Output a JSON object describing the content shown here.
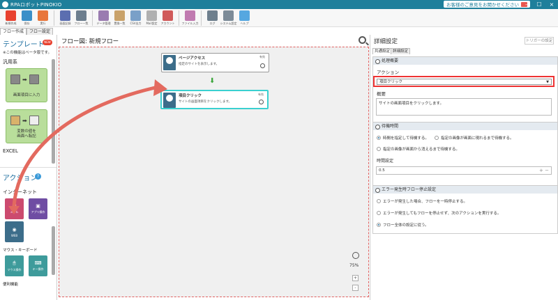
{
  "app": {
    "title": "RPAロボットPINOKIO",
    "feedback": "お客様のご意見をお聞かせください"
  },
  "toolbar": {
    "buttons": [
      {
        "label": "新規作成",
        "icon": "new-doc-icon",
        "color": "#e8412f"
      },
      {
        "label": "保存",
        "icon": "save-icon",
        "color": "#3b8fc8"
      },
      {
        "label": "実行",
        "icon": "run-icon",
        "color": "#e8763b"
      },
      {
        "label": "画面記録",
        "icon": "record-icon",
        "color": "#5b6eb0"
      },
      {
        "label": "フロー一覧",
        "icon": "list-icon",
        "color": "#6d7e8e"
      },
      {
        "label": "データ管理",
        "icon": "database-icon",
        "color": "#9a7bb0"
      },
      {
        "label": "置換一覧",
        "icon": "replace-icon",
        "color": "#c9a26a"
      },
      {
        "label": "CSV出力",
        "icon": "csv-icon",
        "color": "#7aa0c8"
      },
      {
        "label": "Mail設定",
        "icon": "mail-icon",
        "color": "#b0b0b0"
      },
      {
        "label": "アカウント",
        "icon": "account-icon",
        "color": "#d05a5a"
      },
      {
        "label": "ファイル入力",
        "icon": "file-input-icon",
        "color": "#c07ab0"
      },
      {
        "label": "ログ",
        "icon": "log-icon",
        "color": "#6e7f8d"
      },
      {
        "label": "システム設定",
        "icon": "gear-icon",
        "color": "#7c8b98"
      },
      {
        "label": "ヘルプ",
        "icon": "help-icon",
        "color": "#56a7e0"
      }
    ]
  },
  "left_tabs": [
    "フロー作成",
    "フロー設定"
  ],
  "left": {
    "template_heading": "テンプレート",
    "new_badge": "NEW",
    "beta_note": "※この機能はベータ版です。",
    "section_general": "汎用系",
    "cards": [
      {
        "label": "画面項目に入力"
      },
      {
        "label": "変数の値を\n画面へ転記"
      }
    ],
    "section_excel": "EXCEL",
    "action_heading": "アクション",
    "section_internet": "インターネット",
    "tiles_internet": [
      {
        "label": "メール",
        "color": "#cc4a6f"
      },
      {
        "label": "アプリ操作",
        "color": "#6f4da3"
      },
      {
        "label": "WEB",
        "color": "#3c6d8a"
      }
    ],
    "section_mouse": "マウス・キーボード",
    "tiles_mouse": [
      {
        "label": "マウス操作",
        "color": "#3e9b9b"
      },
      {
        "label": "キー操作",
        "color": "#3e9b9b"
      }
    ],
    "section_util": "便利機能"
  },
  "flow": {
    "header": "フロー図:  新規フロー",
    "steps": [
      {
        "name": "ページアクセス",
        "desc": "指定のサイトを表示します。",
        "flag": "有効"
      },
      {
        "name": "項目クリック",
        "desc": "サイトの画面項目をクリックします。",
        "flag": "有効"
      }
    ],
    "zoom": "75%"
  },
  "detail": {
    "title": "詳細設定",
    "trigger_btn": "トリガーの設定",
    "tabs": [
      "共通設定",
      "詳細設定"
    ],
    "sec_processing": "処理概要",
    "action_label": "アクション",
    "action_value": "項目クリック",
    "summary_label": "概要",
    "summary_value": "サイトの画面項目をクリックします。",
    "sec_wait": "待機時間",
    "wait_options": [
      {
        "label": "時間を指定して待機する。",
        "checked": true
      },
      {
        "label": "指定の画像が画面に現れるまで待機する。",
        "checked": false
      },
      {
        "label": "指定の画像が画面から消えるまで待機する。",
        "checked": false
      }
    ],
    "time_label": "時間設定",
    "time_value": "0.5",
    "sec_error": "エラー発生時フロー停止設定",
    "error_options": [
      {
        "label": "エラーが発生した場合、フローを一時停止する。",
        "checked": false
      },
      {
        "label": "エラーが発生してもフローを停止せず、次のアクションを実行する。",
        "checked": false
      },
      {
        "label": "フロー全体の設定に従う。",
        "checked": true
      }
    ]
  }
}
